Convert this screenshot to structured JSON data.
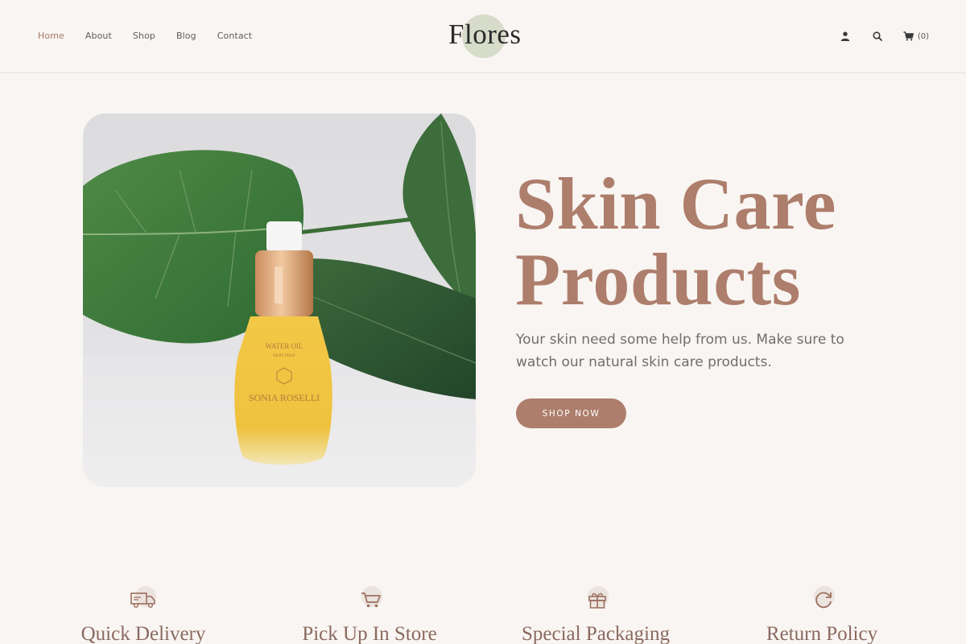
{
  "brand": {
    "logo_text": "Flores"
  },
  "nav": {
    "items": [
      {
        "label": "Home",
        "active": true
      },
      {
        "label": "About"
      },
      {
        "label": "Shop"
      },
      {
        "label": "Blog"
      },
      {
        "label": "Contact"
      }
    ]
  },
  "header": {
    "account_icon": "user-icon",
    "search_icon": "search-icon",
    "cart_icon": "cart-icon",
    "cart_count": "(0)"
  },
  "hero": {
    "image_label": "WATER OIL",
    "image_sublabel": "SKIN PREP",
    "image_brand": "SONIA ROSELLI",
    "title_line1": "Skin Care",
    "title_line2": "Products",
    "description": "Your skin need some help from us. Make sure to watch our natural skin care products.",
    "cta_label": "SHOP NOW"
  },
  "features": [
    {
      "title": "Quick Delivery",
      "icon": "truck-icon"
    },
    {
      "title": "Pick Up In Store",
      "icon": "cart-icon"
    },
    {
      "title": "Special Packaging",
      "icon": "gift-icon"
    },
    {
      "title": "Return Policy",
      "icon": "return-icon"
    }
  ],
  "colors": {
    "accent": "#ad7e6c",
    "background": "#f9f5f2",
    "logo_circle": "#d6dcc9"
  }
}
